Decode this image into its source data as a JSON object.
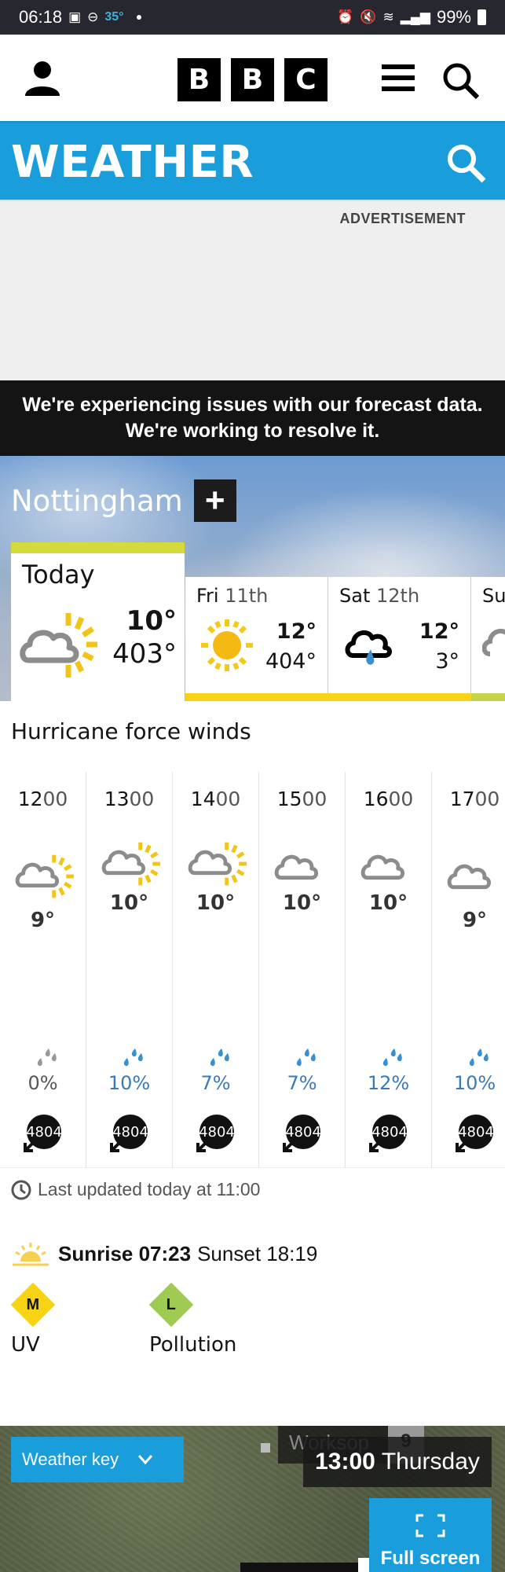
{
  "status_bar": {
    "time": "06:18",
    "temperature": "35°",
    "battery": "99%",
    "icons": [
      "gallery-icon",
      "do-not-disturb-icon",
      "alarm-icon",
      "mute-icon",
      "wifi-icon",
      "signal-icon",
      "battery-icon"
    ]
  },
  "header": {
    "logo_letters": [
      "B",
      "B",
      "C"
    ],
    "account_icon": "account-icon",
    "menu_icon": "menu-icon",
    "search_icon": "search-icon"
  },
  "weather_bar": {
    "title": "WEATHER",
    "search_icon": "search-icon"
  },
  "advertisement": {
    "label": "ADVERTISEMENT"
  },
  "alert": {
    "line1": "We're experiencing issues with our forecast data.",
    "line2": "We're working to resolve it."
  },
  "location": {
    "name": "Nottingham",
    "add_label": "+"
  },
  "days": [
    {
      "name": "Today",
      "date": "",
      "high": "10°",
      "low": "403°",
      "icon": "sunny-intervals-icon",
      "selected": true
    },
    {
      "name": "Fri",
      "date": "11th",
      "high": "12°",
      "low": "404°",
      "icon": "sunny-icon"
    },
    {
      "name": "Sat",
      "date": "12th",
      "high": "12°",
      "low": "3°",
      "icon": "light-rain-icon"
    },
    {
      "name": "Su",
      "date": "",
      "high": "",
      "low": "",
      "icon": "cloud-icon"
    }
  ],
  "summary": "Hurricane force winds",
  "hours": [
    {
      "hour": "12",
      "mins": "00",
      "temp": "9°",
      "icon": "sunny-intervals-icon",
      "rain": "0%",
      "wind": "4804"
    },
    {
      "hour": "13",
      "mins": "00",
      "temp": "10°",
      "icon": "sunny-intervals-icon",
      "rain": "10%",
      "wind": "4804"
    },
    {
      "hour": "14",
      "mins": "00",
      "temp": "10°",
      "icon": "sunny-intervals-icon",
      "rain": "7%",
      "wind": "4804"
    },
    {
      "hour": "15",
      "mins": "00",
      "temp": "10°",
      "icon": "cloud-icon",
      "rain": "7%",
      "wind": "4804"
    },
    {
      "hour": "16",
      "mins": "00",
      "temp": "10°",
      "icon": "cloud-icon",
      "rain": "12%",
      "wind": "4804"
    },
    {
      "hour": "17",
      "mins": "00",
      "temp": "9°",
      "icon": "cloud-icon",
      "rain": "10%",
      "wind": "4804"
    }
  ],
  "last_updated": "Last updated today at 11:00",
  "sun": {
    "sunrise_label": "Sunrise 07:23",
    "sunset_label": "Sunset 18:19"
  },
  "uv": {
    "level": "M",
    "label": "UV",
    "color": "#f7d313"
  },
  "pollution": {
    "level": "L",
    "label": "Pollution",
    "color": "#9fcb52"
  },
  "map": {
    "weather_key_label": "Weather key",
    "town": "Worksop",
    "town_temp": "9",
    "time": "13:00",
    "day": "Thursday",
    "fullscreen_label": "Full screen"
  },
  "colors": {
    "brand_blue": "#1a9ddb",
    "alert_bg": "#141414",
    "today_accent": "#d4d93c",
    "sun_yellow": "#f7d313",
    "rain_blue": "#3a7ab7"
  }
}
